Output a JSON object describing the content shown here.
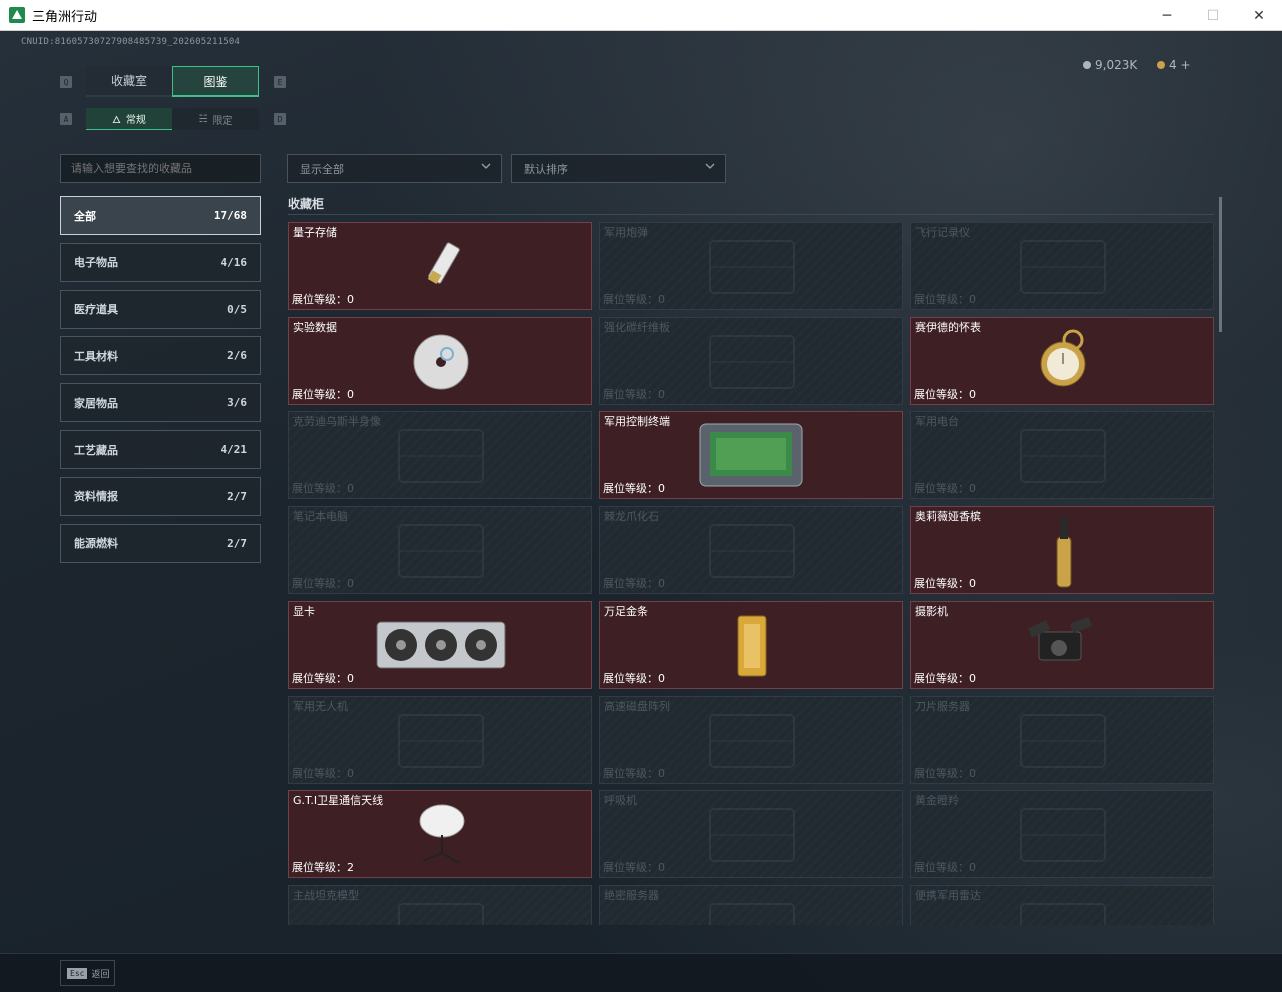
{
  "window": {
    "title": "三角洲行动",
    "controls": [
      "─",
      "☐",
      "✕"
    ]
  },
  "header": {
    "uid": "CNUID:8160573072790848573​9_202605211504",
    "currency": [
      {
        "name": "coin-silver",
        "value": "9,023K",
        "color": "#aeb6bd"
      },
      {
        "name": "coin-gold",
        "value": "4 +",
        "color": "#c9a24a"
      }
    ]
  },
  "tabs": {
    "key_left": "Q",
    "key_right": "E",
    "items": [
      {
        "label": "收藏室",
        "active": false
      },
      {
        "label": "图鉴",
        "active": true
      }
    ]
  },
  "subtabs": {
    "key_left": "A",
    "key_right": "D",
    "items": [
      {
        "label": "常规",
        "icon": "🜂",
        "active": true
      },
      {
        "label": "限定",
        "icon": "☵",
        "active": false
      }
    ]
  },
  "search": {
    "placeholder": "请输入想要查找的收藏品"
  },
  "filters": {
    "filter_value": "显示全部",
    "sort_value": "默认排序"
  },
  "categories": [
    {
      "label": "全部",
      "count": "17/68",
      "active": true
    },
    {
      "label": "电子物品",
      "count": "4/16",
      "active": false
    },
    {
      "label": "医疗道具",
      "count": "0/5",
      "active": false
    },
    {
      "label": "工具材料",
      "count": "2/6",
      "active": false
    },
    {
      "label": "家居物品",
      "count": "3/6",
      "active": false
    },
    {
      "label": "工艺藏品",
      "count": "4/21",
      "active": false
    },
    {
      "label": "资料情报",
      "count": "2/7",
      "active": false
    },
    {
      "label": "能源燃料",
      "count": "2/7",
      "active": false
    }
  ],
  "section": {
    "title": "收藏柜"
  },
  "cards": [
    {
      "name": "量子存储",
      "level": "展位等级：0",
      "unlocked": true,
      "icon": "usb-drive-icon"
    },
    {
      "name": "军用炮弹",
      "level": "展位等级：0",
      "unlocked": false,
      "icon": "shell-icon"
    },
    {
      "name": "飞行记录仪",
      "level": "展位等级：0",
      "unlocked": false,
      "icon": "flight-recorder-icon"
    },
    {
      "name": "实验数据",
      "level": "展位等级：0",
      "unlocked": true,
      "icon": "disc-icon"
    },
    {
      "name": "强化碳纤维板",
      "level": "展位等级：0",
      "unlocked": false,
      "icon": "carbon-plate-icon"
    },
    {
      "name": "赛伊德的怀表",
      "level": "展位等级：0",
      "unlocked": true,
      "icon": "pocket-watch-icon"
    },
    {
      "name": "克劳迪乌斯半身像",
      "level": "展位等级：0",
      "unlocked": false,
      "icon": "bust-icon"
    },
    {
      "name": "军用控制终端",
      "level": "展位等级：0",
      "unlocked": true,
      "icon": "control-terminal-icon"
    },
    {
      "name": "军用电台",
      "level": "展位等级：0",
      "unlocked": false,
      "icon": "radio-icon"
    },
    {
      "name": "笔记本电脑",
      "level": "展位等级：0",
      "unlocked": false,
      "icon": "laptop-icon"
    },
    {
      "name": "棘龙爪化石",
      "level": "展位等级：0",
      "unlocked": false,
      "icon": "fossil-icon"
    },
    {
      "name": "奥莉薇娅香槟",
      "level": "展位等级：0",
      "unlocked": true,
      "icon": "champagne-icon"
    },
    {
      "name": "显卡",
      "level": "展位等级：0",
      "unlocked": true,
      "icon": "gpu-icon"
    },
    {
      "name": "万足金条",
      "level": "展位等级：0",
      "unlocked": true,
      "icon": "gold-bar-icon"
    },
    {
      "name": "摄影机",
      "level": "展位等级：0",
      "unlocked": true,
      "icon": "camera-icon"
    },
    {
      "name": "军用无人机",
      "level": "展位等级：0",
      "unlocked": false,
      "icon": "drone-icon"
    },
    {
      "name": "高速磁盘阵列",
      "level": "展位等级：0",
      "unlocked": false,
      "icon": "disk-array-icon"
    },
    {
      "name": "刀片服务器",
      "level": "展位等级：0",
      "unlocked": false,
      "icon": "blade-server-icon"
    },
    {
      "name": "G.T.I卫星通信天线",
      "level": "展位等级：2",
      "unlocked": true,
      "icon": "satellite-dish-icon"
    },
    {
      "name": "呼吸机",
      "level": "展位等级：0",
      "unlocked": false,
      "icon": "ventilator-icon"
    },
    {
      "name": "黄金瞪羚",
      "level": "展位等级：0",
      "unlocked": false,
      "icon": "gazelle-icon"
    },
    {
      "name": "主战坦克模型",
      "level": "",
      "unlocked": false,
      "icon": "tank-model-icon"
    },
    {
      "name": "绝密服务器",
      "level": "",
      "unlocked": false,
      "icon": "server-icon"
    },
    {
      "name": "便携军用雷达",
      "level": "",
      "unlocked": false,
      "icon": "radar-icon"
    }
  ],
  "footer": {
    "key": "Esc",
    "label": "返回"
  }
}
